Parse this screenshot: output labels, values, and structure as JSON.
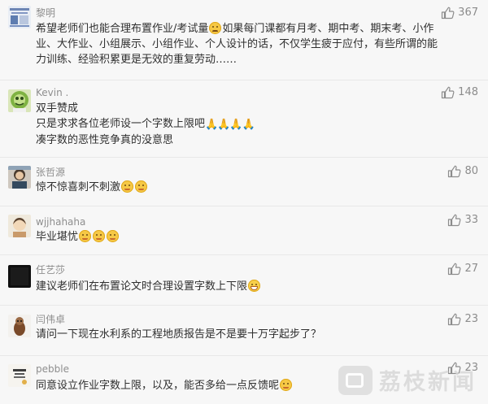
{
  "comments": [
    {
      "name": "黎明",
      "likes": "367",
      "lines": [
        "希望老师们也能合理布置作业/考试量",
        "如果每门课都有月考、期中考、期末考、小作",
        "业、大作业、小组展示、小组作业、个人设计的话，不仅学生疲于应付，有些所谓的能",
        "力训练、经验积累更是无效的重复劳动……"
      ],
      "emoji": "sad-face"
    },
    {
      "name": "Kevin .",
      "likes": "148",
      "lines": [
        "双手赞成",
        "只是求求各位老师设一个字数上限吧",
        "凑字数的恶性竞争真的没意思"
      ],
      "emoji": "praying-hands"
    },
    {
      "name": "张哲源",
      "likes": "80",
      "lines": [
        "惊不惊喜刺不刺激"
      ],
      "emoji": "grin-face"
    },
    {
      "name": "wjjhahaha",
      "likes": "33",
      "lines": [
        "毕业堪忧"
      ],
      "emoji": "grin-face"
    },
    {
      "name": "任艺莎",
      "likes": "27",
      "lines": [
        "建议老师们在布置论文时合理设置字数上下限"
      ],
      "emoji": "smile-face"
    },
    {
      "name": "闫伟卓",
      "likes": "23",
      "lines": [
        "请问一下现在水利系的工程地质报告是不是要十万字起步了？"
      ],
      "emoji": ""
    },
    {
      "name": "pebble",
      "likes": "23",
      "lines": [
        "同意设立作业字数上限，以及，能否多给一点反馈呢"
      ],
      "emoji": "laugh-face"
    }
  ],
  "watermark": {
    "text": "荔枝新闻",
    "icon": "brand-logo-icon"
  },
  "colors": {
    "background": "#f7f7f7",
    "name": "#8e8e8e",
    "text": "#2f2f2f",
    "likes": "#8c8c8c"
  }
}
